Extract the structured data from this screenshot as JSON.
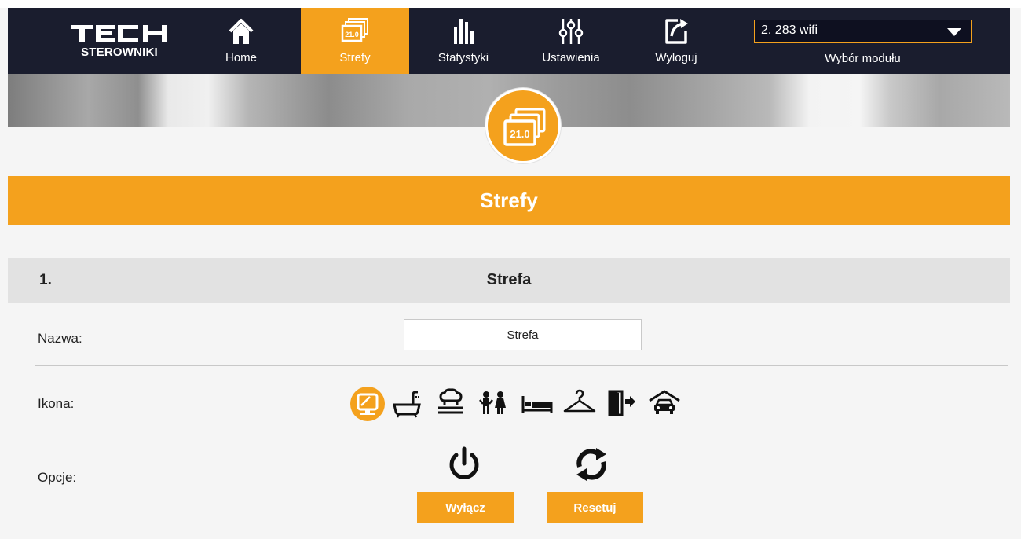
{
  "brand": {
    "name": "TECH",
    "subtitle": "STEROWNIKI"
  },
  "nav": {
    "items": [
      {
        "label": "Home",
        "icon": "home-icon",
        "active": false
      },
      {
        "label": "Strefy",
        "icon": "zones-icon",
        "active": true,
        "badge": "21.0"
      },
      {
        "label": "Statystyki",
        "icon": "statistics-icon",
        "active": false
      },
      {
        "label": "Ustawienia",
        "icon": "sliders-icon",
        "active": false
      },
      {
        "label": "Wyloguj",
        "icon": "logout-icon",
        "active": false
      }
    ]
  },
  "module": {
    "selected": "2. 283 wifi",
    "label": "Wybór modułu"
  },
  "badge": {
    "value": "21.0"
  },
  "page": {
    "title": "Strefy"
  },
  "zone": {
    "number": "1.",
    "name": "Strefa",
    "fields": {
      "name_label": "Nazwa:",
      "name_value": "Strefa",
      "icon_label": "Ikona:",
      "options_label": "Opcje:"
    },
    "icons": [
      "monitor-icon",
      "bathtub-icon",
      "kitchen-icon",
      "kids-icon",
      "bed-icon",
      "hanger-icon",
      "door-exit-icon",
      "garage-car-icon"
    ],
    "selected_icon": "monitor-icon",
    "options": {
      "off_label": "Wyłącz",
      "reset_label": "Resetuj"
    }
  },
  "colors": {
    "accent": "#f4a11d",
    "nav_bg": "#1a1d2e",
    "header_gray": "#e2e2e2",
    "page_bg": "#f5f5f5"
  }
}
